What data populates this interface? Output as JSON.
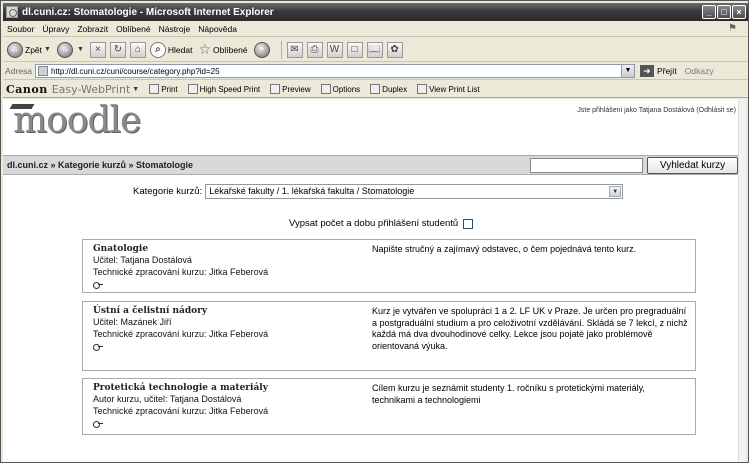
{
  "window": {
    "title": "dl.cuni.cz: Stomatologie - Microsoft Internet Explorer"
  },
  "menu": [
    "Soubor",
    "Úpravy",
    "Zobrazit",
    "Oblíbené",
    "Nástroje",
    "Nápověda"
  ],
  "toolbar": {
    "back": "Zpět",
    "search": "Hledat",
    "favorites": "Oblíbené"
  },
  "address": {
    "label": "Adresa",
    "url": "http://dl.cuni.cz/cuni/course/category.php?id=25",
    "go": "Přejít",
    "links": "Odkazy"
  },
  "canon": {
    "logo": "Canon",
    "product": "Easy-WebPrint",
    "buttons": [
      "Print",
      "High Speed Print",
      "Preview",
      "Options",
      "Duplex",
      "View Print List"
    ]
  },
  "moodle": {
    "logo": "moodle",
    "login_info": "Jste přihlášeni jako Tatjana Dostálová (Odhlásit se)"
  },
  "nav": {
    "breadcrumb": "dl.cuni.cz » Kategorie kurzů » Stomatologie",
    "search_value": "",
    "search_button": "Vyhledat kurzy"
  },
  "category": {
    "label": "Kategorie kurzů:",
    "selected": "Lékařské fakulty / 1. lékařská fakulta / Stomatologie"
  },
  "count_toggle": {
    "label": "Vypsat počet a dobu přihlášení studentů",
    "checked": false
  },
  "courses": [
    {
      "name": "Gnatologie",
      "lines": [
        "Učitel: Tatjana Dostálová",
        "Technické zpracování kurzu: Jitka Feberová"
      ],
      "summary": "Napište stručný a zajímavý odstavec, o čem pojednává tento kurz."
    },
    {
      "name": "Ústní a čelistní nádory",
      "lines": [
        "Učitel: Mazánek Jiří",
        "Technické zpracování kurzu: Jitka Feberová"
      ],
      "summary": "Kurz je vytvářen ve spolupráci 1 a 2. LF UK v Praze. Je určen pro pregraduální a postgraduální studium a pro celoživotní vzdělávání. Skládá se 7 lekcí, z nichž každá má dva dvouhodinové celky. Lekce jsou pojaté jako problémově orientovaná výuka."
    },
    {
      "name": "Protetická technologie a materiály",
      "lines": [
        "Autor kurzu, učitel: Tatjana Dostálová",
        "Technické zpracování kurzu: Jitka Feberová"
      ],
      "summary": "Cílem kurzu je seznámit studenty 1. ročníku s protetickými materiály, technikami a technologiemi"
    }
  ]
}
